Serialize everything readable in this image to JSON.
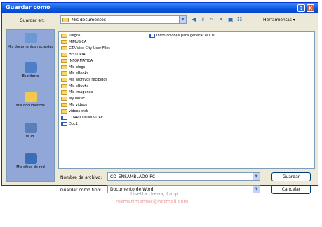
{
  "window": {
    "title": "Guardar como",
    "help": "?",
    "close": "X"
  },
  "toolbar": {
    "lookin_label": "Guardar en:",
    "lookin_value": "Mis documentos",
    "tools_label": "Herramientas"
  },
  "places": [
    {
      "label": "Mis documentos recientes",
      "icon": "recent-docs-icon"
    },
    {
      "label": "Escritorio",
      "icon": "desktop-icon"
    },
    {
      "label": "Mis documentos",
      "icon": "my-documents-icon"
    },
    {
      "label": "Mi PC",
      "icon": "my-computer-icon"
    },
    {
      "label": "Mis sitios de red",
      "icon": "network-places-icon"
    }
  ],
  "files": [
    {
      "name": "juegos",
      "type": "folder"
    },
    {
      "name": "MIMUSICA",
      "type": "folder"
    },
    {
      "name": "GTA Vice City User Files",
      "type": "folder"
    },
    {
      "name": "HISTORIA",
      "type": "folder"
    },
    {
      "name": "INFORMATICA",
      "type": "folder"
    },
    {
      "name": "Mis blogs",
      "type": "folder"
    },
    {
      "name": "Mis eBooks",
      "type": "folder"
    },
    {
      "name": "Mis archivos recibidos",
      "type": "folder"
    },
    {
      "name": "Mis eBooks",
      "type": "folder"
    },
    {
      "name": "Mis imágenes",
      "type": "folder"
    },
    {
      "name": "My Music",
      "type": "folder"
    },
    {
      "name": "Mis videos",
      "type": "folder"
    },
    {
      "name": "videos web",
      "type": "folder"
    },
    {
      "name": "CURRICULUM VITAE",
      "type": "doc"
    },
    {
      "name": "Doc1",
      "type": "doc"
    },
    {
      "name": "Instrucciones para generar el CD",
      "type": "doc"
    }
  ],
  "filename": {
    "label": "Nombre de archivo:",
    "value": "CD_ENSAMBLADO PC"
  },
  "filetype": {
    "label": "Guardar como tipo:",
    "value": "Documento de Word"
  },
  "buttons": {
    "save": "Guardar",
    "cancel": "Cancelar"
  },
  "credit": {
    "line1": "Lisetta Urena, Lapp",
    "line2": "rosmarimontes@hotmail.com"
  }
}
